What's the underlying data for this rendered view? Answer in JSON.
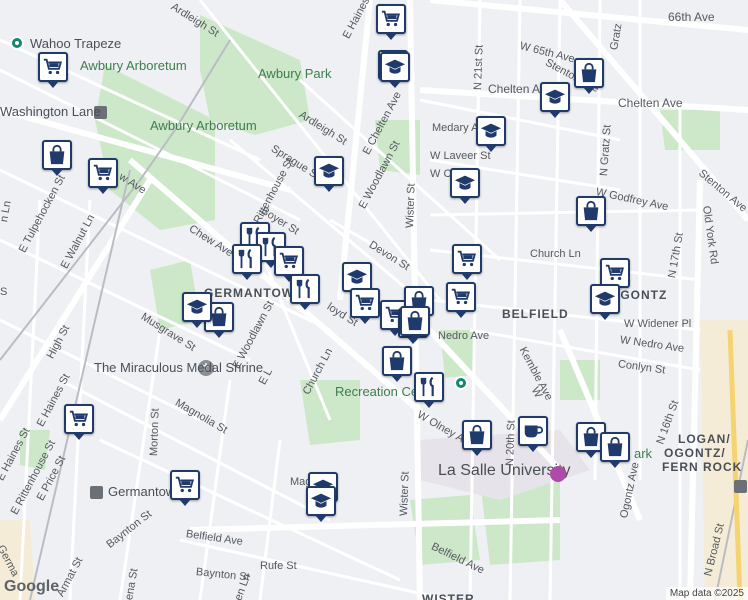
{
  "map": {
    "attribution": "Map data ©2025",
    "logo": "Google",
    "places": {
      "wahoo_trapeze": "Wahoo Trapeze",
      "awbury_arboretum_top": "Awbury Arboretum",
      "awbury_park": "Awbury Park",
      "washington_lane": "Washington Lane",
      "awbury_arboretum_mid": "Awbury Arboretum",
      "germantown_area": "GERMANTOWN",
      "miraculous_medal": "The Miraculous Medal Shrine",
      "recreation_center": "Recreation Center",
      "la_salle": "La Salle University",
      "belfield": "BELFIELD",
      "ogontz": "OGONTZ",
      "logan": "LOGAN/",
      "ogontz_fern": "OGONTZ/",
      "fern_rock": "FERN ROCK",
      "germantown": "Germantown",
      "wister": "WISTER",
      "park_suffix": "ark"
    },
    "streets": {
      "ardleigh_st_top": "Ardleigh St",
      "e_haines_top": "E Haines St",
      "ardleigh_st_mid": "Ardleigh St",
      "e_chelten": "E Chelten Ave",
      "sprague": "Sprague St",
      "e_woodlawn": "E Woodlawn St",
      "e_rittenhouse": "E Rittenhouse St",
      "boyer": "Boyer St",
      "chew": "Chew Ave",
      "w_ave": "w Ave",
      "e_tulpehocken": "E Tulpehocken St",
      "e_walnut": "E Walnut Ln",
      "high_st": "High St",
      "musgrave": "Musgrave St",
      "e_haines_left": "E Haines St",
      "e_woodlawn_low": "E Woodlawn St",
      "e_l": "E L",
      "church_ln_low": "Church Ln",
      "lloyd": "loyd St",
      "devon": "Devon St",
      "wister_top": "Wister St",
      "wister_bottom": "Wister St",
      "n21": "N 21st St",
      "w65": "W 65th Ave",
      "ave66": "66th Ave",
      "chelten_ave": "Chelten Ave",
      "chelten_ave_right": "Chelten Ave",
      "medary": "Medary Ave",
      "w_laveer": "W Laveer St",
      "w_c": "W C",
      "w_godfrey": "W Godfrey Ave",
      "church_ln": "Church Ln",
      "nedro": "Nedro Ave",
      "kemble": "Kemble Ave",
      "w_widener": "W Widener Pl",
      "w_nedro": "W Nedro Ave",
      "conlyn": "Conlyn St",
      "w_olney": "W Olney Ave",
      "n20": "N 20th St",
      "n16": "N 16th St",
      "n17": "N 17th St",
      "ogontz_ave": "Ogontz Ave",
      "n_broad": "N Broad St",
      "old_york": "Old York Rd",
      "stenton": "Stenton Ave",
      "stenton_right": "Stenton Ave",
      "n_gratz": "N Gratz St",
      "gratz": "Gratz",
      "magnolia": "Magnolia St",
      "morton": "Morton St",
      "baynton": "Baynton St",
      "baynton_low": "Baynton St",
      "belfield_ave": "Belfield Ave",
      "belfield_ave2": "Belfield Ave",
      "rufe": "Rufe St",
      "e_price": "E Price St",
      "e_rittenhouse_low": "E Rittenhouse St",
      "e_haines_low": "E Haines St",
      "lena": "Lena St",
      "armat": "Armat St",
      "germa": "Germa",
      "mag": "Mag",
      "n_ln": "n Ln",
      "w_ky": "W",
      "green": "een Ln",
      "s": "S"
    },
    "pins": [
      {
        "type": "grocery"
      },
      {
        "type": "restaurant"
      },
      {
        "type": "school"
      },
      {
        "type": "grocery"
      },
      {
        "type": "shopping"
      },
      {
        "type": "school"
      },
      {
        "type": "school"
      },
      {
        "type": "school"
      },
      {
        "type": "shopping"
      },
      {
        "type": "grocery"
      },
      {
        "type": "school"
      },
      {
        "type": "shopping"
      },
      {
        "type": "restaurant"
      },
      {
        "type": "restaurant"
      },
      {
        "type": "grocery"
      },
      {
        "type": "restaurant"
      },
      {
        "type": "restaurant"
      },
      {
        "type": "school"
      },
      {
        "type": "grocery"
      },
      {
        "type": "grocery"
      },
      {
        "type": "shopping"
      },
      {
        "type": "grocery"
      },
      {
        "type": "grocery"
      },
      {
        "type": "grocery"
      },
      {
        "type": "school"
      },
      {
        "type": "school"
      },
      {
        "type": "shopping"
      },
      {
        "type": "shopping"
      },
      {
        "type": "grocery"
      },
      {
        "type": "shopping"
      },
      {
        "type": "restaurant"
      },
      {
        "type": "shopping"
      },
      {
        "type": "cafe"
      },
      {
        "type": "shopping"
      },
      {
        "type": "shopping"
      },
      {
        "type": "grocery"
      },
      {
        "type": "grocery"
      },
      {
        "type": "school"
      },
      {
        "type": "school"
      }
    ]
  }
}
